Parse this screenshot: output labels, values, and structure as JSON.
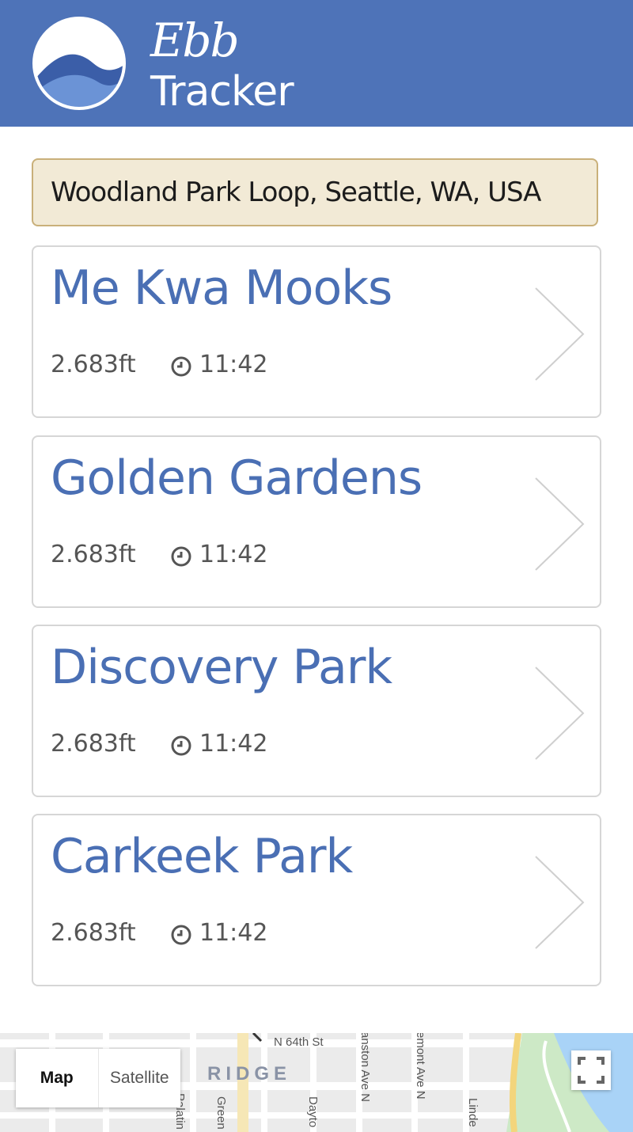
{
  "header": {
    "brand_script": "Ebb",
    "brand_word": "Tracker",
    "color": "#4e73b8"
  },
  "location": {
    "value": "Woodland Park Loop, Seattle, WA, USA"
  },
  "beaches": [
    {
      "name": "Me Kwa Mooks",
      "height": "2.683ft",
      "time": "11:42"
    },
    {
      "name": "Golden Gardens",
      "height": "2.683ft",
      "time": "11:42"
    },
    {
      "name": "Discovery Park",
      "height": "2.683ft",
      "time": "11:42"
    },
    {
      "name": "Carkeek Park",
      "height": "2.683ft",
      "time": "11:42"
    }
  ],
  "map": {
    "toggle": {
      "map": "Map",
      "satellite": "Satellite"
    },
    "labels": {
      "street_64th": "N 64th St",
      "neighborhood": "RIDGE",
      "evanston": "anston Ave N",
      "fremont": "emont Ave N",
      "linden": "Linde",
      "palatine": "Palatin",
      "greenwood": "Green",
      "dayton": "Dayto"
    }
  },
  "icons": {
    "clock": "clock-icon",
    "chevron": "chevron-right-icon",
    "logo": "wave-logo-icon",
    "fullscreen": "fullscreen-icon"
  }
}
